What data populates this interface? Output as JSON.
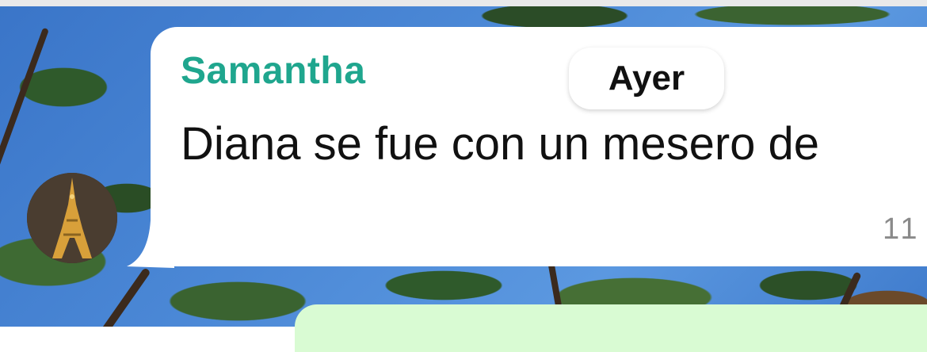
{
  "chat": {
    "date_separator": "Ayer",
    "incoming_message": {
      "sender": "Samantha",
      "text": "Diana se fue con un mesero de",
      "time": "11"
    }
  },
  "colors": {
    "sender_name": "#1fa68e",
    "incoming_bubble": "#ffffff",
    "outgoing_bubble": "#d9fbd3"
  },
  "icons": {
    "avatar": "eiffel-tower-photo"
  }
}
